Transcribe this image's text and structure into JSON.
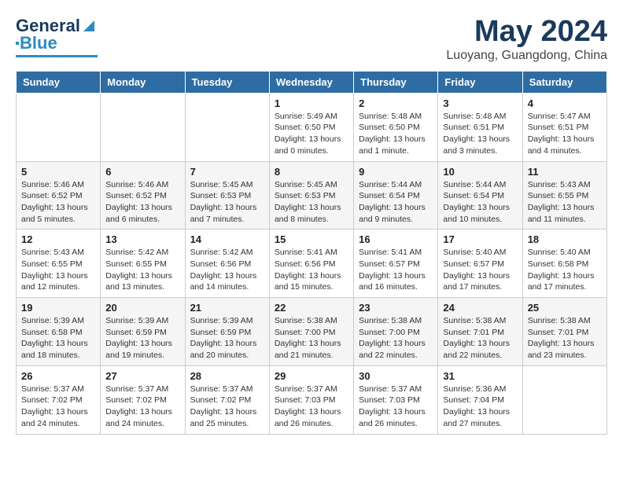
{
  "header": {
    "logo_general": "General",
    "logo_blue": "Blue",
    "title": "May 2024",
    "subtitle": "Luoyang, Guangdong, China"
  },
  "days_of_week": [
    "Sunday",
    "Monday",
    "Tuesday",
    "Wednesday",
    "Thursday",
    "Friday",
    "Saturday"
  ],
  "weeks": [
    [
      {
        "day": "",
        "info": ""
      },
      {
        "day": "",
        "info": ""
      },
      {
        "day": "",
        "info": ""
      },
      {
        "day": "1",
        "info": "Sunrise: 5:49 AM\nSunset: 6:50 PM\nDaylight: 13 hours\nand 0 minutes."
      },
      {
        "day": "2",
        "info": "Sunrise: 5:48 AM\nSunset: 6:50 PM\nDaylight: 13 hours\nand 1 minute."
      },
      {
        "day": "3",
        "info": "Sunrise: 5:48 AM\nSunset: 6:51 PM\nDaylight: 13 hours\nand 3 minutes."
      },
      {
        "day": "4",
        "info": "Sunrise: 5:47 AM\nSunset: 6:51 PM\nDaylight: 13 hours\nand 4 minutes."
      }
    ],
    [
      {
        "day": "5",
        "info": "Sunrise: 5:46 AM\nSunset: 6:52 PM\nDaylight: 13 hours\nand 5 minutes."
      },
      {
        "day": "6",
        "info": "Sunrise: 5:46 AM\nSunset: 6:52 PM\nDaylight: 13 hours\nand 6 minutes."
      },
      {
        "day": "7",
        "info": "Sunrise: 5:45 AM\nSunset: 6:53 PM\nDaylight: 13 hours\nand 7 minutes."
      },
      {
        "day": "8",
        "info": "Sunrise: 5:45 AM\nSunset: 6:53 PM\nDaylight: 13 hours\nand 8 minutes."
      },
      {
        "day": "9",
        "info": "Sunrise: 5:44 AM\nSunset: 6:54 PM\nDaylight: 13 hours\nand 9 minutes."
      },
      {
        "day": "10",
        "info": "Sunrise: 5:44 AM\nSunset: 6:54 PM\nDaylight: 13 hours\nand 10 minutes."
      },
      {
        "day": "11",
        "info": "Sunrise: 5:43 AM\nSunset: 6:55 PM\nDaylight: 13 hours\nand 11 minutes."
      }
    ],
    [
      {
        "day": "12",
        "info": "Sunrise: 5:43 AM\nSunset: 6:55 PM\nDaylight: 13 hours\nand 12 minutes."
      },
      {
        "day": "13",
        "info": "Sunrise: 5:42 AM\nSunset: 6:55 PM\nDaylight: 13 hours\nand 13 minutes."
      },
      {
        "day": "14",
        "info": "Sunrise: 5:42 AM\nSunset: 6:56 PM\nDaylight: 13 hours\nand 14 minutes."
      },
      {
        "day": "15",
        "info": "Sunrise: 5:41 AM\nSunset: 6:56 PM\nDaylight: 13 hours\nand 15 minutes."
      },
      {
        "day": "16",
        "info": "Sunrise: 5:41 AM\nSunset: 6:57 PM\nDaylight: 13 hours\nand 16 minutes."
      },
      {
        "day": "17",
        "info": "Sunrise: 5:40 AM\nSunset: 6:57 PM\nDaylight: 13 hours\nand 17 minutes."
      },
      {
        "day": "18",
        "info": "Sunrise: 5:40 AM\nSunset: 6:58 PM\nDaylight: 13 hours\nand 17 minutes."
      }
    ],
    [
      {
        "day": "19",
        "info": "Sunrise: 5:39 AM\nSunset: 6:58 PM\nDaylight: 13 hours\nand 18 minutes."
      },
      {
        "day": "20",
        "info": "Sunrise: 5:39 AM\nSunset: 6:59 PM\nDaylight: 13 hours\nand 19 minutes."
      },
      {
        "day": "21",
        "info": "Sunrise: 5:39 AM\nSunset: 6:59 PM\nDaylight: 13 hours\nand 20 minutes."
      },
      {
        "day": "22",
        "info": "Sunrise: 5:38 AM\nSunset: 7:00 PM\nDaylight: 13 hours\nand 21 minutes."
      },
      {
        "day": "23",
        "info": "Sunrise: 5:38 AM\nSunset: 7:00 PM\nDaylight: 13 hours\nand 22 minutes."
      },
      {
        "day": "24",
        "info": "Sunrise: 5:38 AM\nSunset: 7:01 PM\nDaylight: 13 hours\nand 22 minutes."
      },
      {
        "day": "25",
        "info": "Sunrise: 5:38 AM\nSunset: 7:01 PM\nDaylight: 13 hours\nand 23 minutes."
      }
    ],
    [
      {
        "day": "26",
        "info": "Sunrise: 5:37 AM\nSunset: 7:02 PM\nDaylight: 13 hours\nand 24 minutes."
      },
      {
        "day": "27",
        "info": "Sunrise: 5:37 AM\nSunset: 7:02 PM\nDaylight: 13 hours\nand 24 minutes."
      },
      {
        "day": "28",
        "info": "Sunrise: 5:37 AM\nSunset: 7:02 PM\nDaylight: 13 hours\nand 25 minutes."
      },
      {
        "day": "29",
        "info": "Sunrise: 5:37 AM\nSunset: 7:03 PM\nDaylight: 13 hours\nand 26 minutes."
      },
      {
        "day": "30",
        "info": "Sunrise: 5:37 AM\nSunset: 7:03 PM\nDaylight: 13 hours\nand 26 minutes."
      },
      {
        "day": "31",
        "info": "Sunrise: 5:36 AM\nSunset: 7:04 PM\nDaylight: 13 hours\nand 27 minutes."
      },
      {
        "day": "",
        "info": ""
      }
    ]
  ]
}
